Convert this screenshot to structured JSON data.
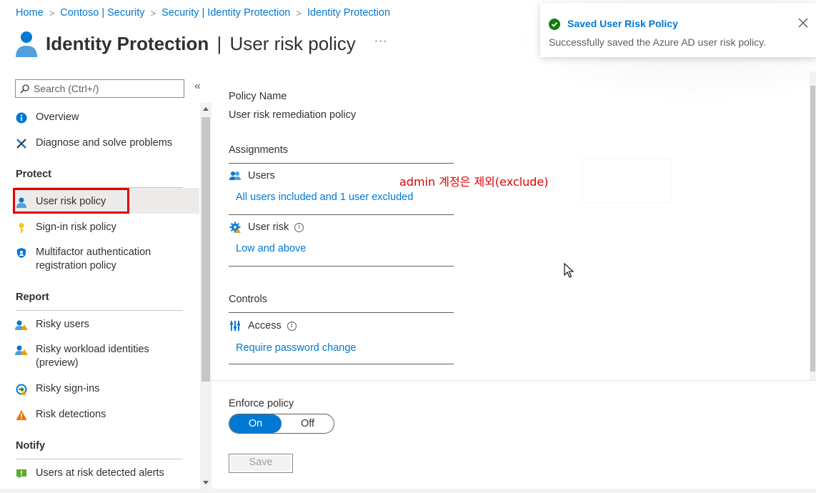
{
  "breadcrumb": [
    "Home",
    "Contoso | Security",
    "Security | Identity Protection",
    "Identity Protection"
  ],
  "header": {
    "title_bold": "Identity Protection",
    "title_sep": "|",
    "title_rest": "User risk policy",
    "more": "···"
  },
  "toast": {
    "title": "Saved User Risk Policy",
    "message": "Successfully saved the Azure AD user risk policy."
  },
  "sidebar": {
    "search_placeholder": "Search (Ctrl+/)",
    "collapse": "«",
    "top_items": [
      {
        "label": "Overview",
        "icon": "info-icon"
      },
      {
        "label": "Diagnose and solve problems",
        "icon": "wrench-icon"
      }
    ],
    "sections": [
      {
        "heading": "Protect",
        "items": [
          {
            "label": "User risk policy",
            "icon": "user-icon",
            "selected": true
          },
          {
            "label": "Sign-in risk policy",
            "icon": "key-icon"
          },
          {
            "label": "Multifactor authentication registration policy",
            "icon": "shield-icon"
          }
        ]
      },
      {
        "heading": "Report",
        "items": [
          {
            "label": "Risky users",
            "icon": "risky-users-icon"
          },
          {
            "label": "Risky workload identities (preview)",
            "icon": "risky-workload-icon"
          },
          {
            "label": "Risky sign-ins",
            "icon": "risky-signin-icon"
          },
          {
            "label": "Risk detections",
            "icon": "warning-icon"
          }
        ]
      },
      {
        "heading": "Notify",
        "items": [
          {
            "label": "Users at risk detected alerts",
            "icon": "alert-icon"
          }
        ]
      }
    ]
  },
  "main": {
    "policy_name_label": "Policy Name",
    "policy_name_value": "User risk remediation policy",
    "assignments_heading": "Assignments",
    "users_label": "Users",
    "users_value": "All users included and 1 user excluded",
    "user_risk_label": "User risk",
    "user_risk_value": "Low and above",
    "controls_heading": "Controls",
    "access_label": "Access",
    "access_value": "Require password change",
    "enforce_label": "Enforce policy",
    "toggle_on": "On",
    "toggle_off": "Off",
    "toggle_state": "On",
    "save_label": "Save",
    "info_glyph": "i"
  },
  "annotation": "admin 계정은 제외(exclude)",
  "colors": {
    "accent": "#0078d4",
    "success": "#107c10",
    "annotation": "#e00000"
  }
}
